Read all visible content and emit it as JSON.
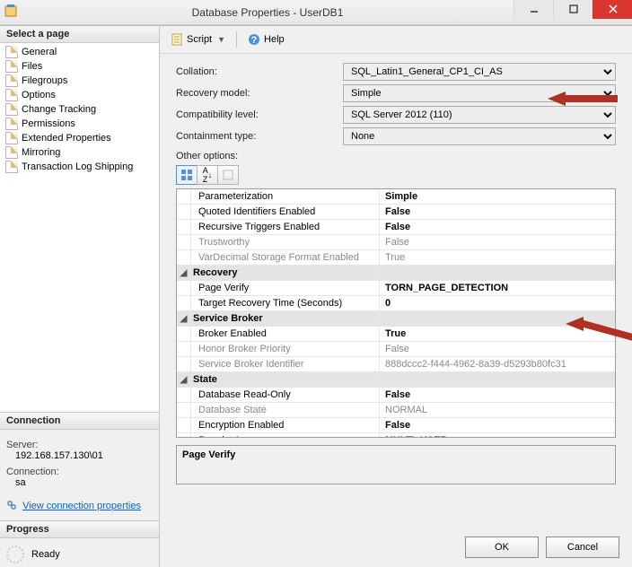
{
  "window": {
    "title": "Database Properties - UserDB1"
  },
  "left": {
    "select_page": "Select a page",
    "pages": [
      "General",
      "Files",
      "Filegroups",
      "Options",
      "Change Tracking",
      "Permissions",
      "Extended Properties",
      "Mirroring",
      "Transaction Log Shipping"
    ],
    "connection_hdr": "Connection",
    "server_lbl": "Server:",
    "server_val": "192.168.157.130\\01",
    "conn_lbl": "Connection:",
    "conn_val": "sa",
    "viewprops": "View connection properties",
    "progress_hdr": "Progress",
    "ready": "Ready"
  },
  "toolbar": {
    "script": "Script",
    "help": "Help"
  },
  "form": {
    "collation_lbl": "Collation:",
    "collation_val": "SQL_Latin1_General_CP1_CI_AS",
    "recovery_lbl": "Recovery model:",
    "recovery_val": "Simple",
    "compat_lbl": "Compatibility level:",
    "compat_val": "SQL Server 2012 (110)",
    "contain_lbl": "Containment type:",
    "contain_val": "None",
    "other_lbl": "Other options:"
  },
  "grid": {
    "rows": [
      {
        "type": "prop",
        "label": "Parameterization",
        "value": "Simple",
        "bold": true
      },
      {
        "type": "prop",
        "label": "Quoted Identifiers Enabled",
        "value": "False",
        "bold": true
      },
      {
        "type": "prop",
        "label": "Recursive Triggers Enabled",
        "value": "False",
        "bold": true
      },
      {
        "type": "prop",
        "label": "Trustworthy",
        "value": "False",
        "dim": true
      },
      {
        "type": "prop",
        "label": "VarDecimal Storage Format Enabled",
        "value": "True",
        "dim": true
      },
      {
        "type": "cat",
        "label": "Recovery"
      },
      {
        "type": "prop",
        "label": "Page Verify",
        "value": "TORN_PAGE_DETECTION",
        "bold": true
      },
      {
        "type": "prop",
        "label": "Target Recovery Time (Seconds)",
        "value": "0",
        "bold": true
      },
      {
        "type": "cat",
        "label": "Service Broker"
      },
      {
        "type": "prop",
        "label": "Broker Enabled",
        "value": "True",
        "bold": true
      },
      {
        "type": "prop",
        "label": "Honor Broker Priority",
        "value": "False",
        "dim": true
      },
      {
        "type": "prop",
        "label": "Service Broker Identifier",
        "value": "888dccc2-f444-4962-8a39-d5293b80fc31",
        "dim": true
      },
      {
        "type": "cat",
        "label": "State"
      },
      {
        "type": "prop",
        "label": "Database Read-Only",
        "value": "False",
        "bold": true
      },
      {
        "type": "prop",
        "label": "Database State",
        "value": "NORMAL",
        "dim": true
      },
      {
        "type": "prop",
        "label": "Encryption Enabled",
        "value": "False",
        "bold": true
      },
      {
        "type": "prop",
        "label": "Restrict Access",
        "value": "MULTI_USER",
        "bold": true
      }
    ]
  },
  "desc": {
    "title": "Page Verify"
  },
  "buttons": {
    "ok": "OK",
    "cancel": "Cancel"
  }
}
